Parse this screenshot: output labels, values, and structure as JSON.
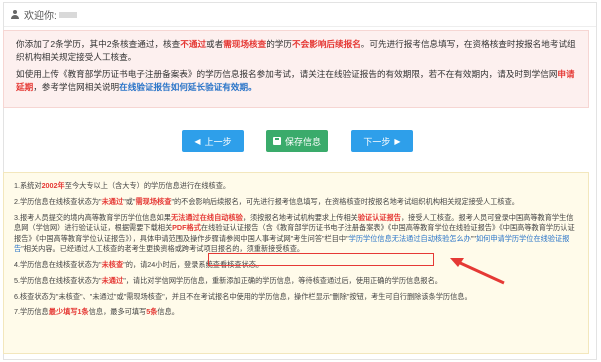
{
  "header": {
    "greeting": "欢迎你:"
  },
  "notice": {
    "p1_a": "你添加了2条学历，其中2条核查通过，核查",
    "p1_b": "不通过",
    "p1_c": "或者",
    "p1_d": "需现场核查",
    "p1_e": "的学历",
    "p1_f": "不会影响后续报名",
    "p1_g": "。可先进行报考信息填写，在资格核查时按报名地考试组织机构相关规定接受人工核查。",
    "p2_a": "如使用上传《教育部学历证书电子注册备案表》的学历信息报名参加考试，请关注在线验证报告的有效期限，若不在有效期内，请及时到学信网",
    "p2_b": "申请延期",
    "p2_c": "，参考学信网相关说明",
    "p2_d": "在线验证报告如何延长验证有效期。"
  },
  "buttons": {
    "prev": "上一步",
    "save": "保存信息",
    "next": "下一步"
  },
  "notes": {
    "n1_a": "1.系统对",
    "n1_b": "2002年",
    "n1_c": "至今大专以上（含大专）的学历信息进行在线核查。",
    "n2_a": "2.学历信息在线核查状态为\"",
    "n2_b": "未通过",
    "n2_c": "\"或\"",
    "n2_d": "需现场核查",
    "n2_e": "\"的不会影响后续报名，可先进行报考信息填写，在资格核查时按报名地考试组织机构相关规定接受人工核查。",
    "n3_a": "3.报考人员提交的境内高等教育学历学位信息如果",
    "n3_b": "无法通过在线自动核验",
    "n3_c": "，须按报名地考试机构要求上传相关",
    "n3_d": "验证认证报告",
    "n3_e": "，接受人工核查。报考人员可登录中国高等教育学生信息网（学信网）进行验证认证，根据需要下载相关",
    "n3_f": "PDF格式",
    "n3_g": "在线验证认证报告（含《教育部学历证书电子注册备案表》《中国高等教育学位在线验证报告》《中国高等教育学历认证报告》《中国高等教育学位认证报告》），具体申请范围及操作步骤请参阅中国人事考试网\"考生问答\"栏目中\"",
    "n3_h": "学历学位信息无法通过自动核验怎么办",
    "n3_i": "\"\"",
    "n3_j": "如何申请学历学位在线验证报告",
    "n3_k": "\"相关内容。",
    "n3_l": "已经通过人工核查的老考生更换资格或跨考试项目报名的，须重新接受核查。",
    "n4_a": "4.学历信息在线核查状态为\"",
    "n4_b": "未核查",
    "n4_c": "\"的，请24小时后，登录系统查看核查状态。",
    "n5_a": "5.学历信息在线核查状态为\"",
    "n5_b": "未通过",
    "n5_c": "\"，请比对学信网学历信息，重新添加正确的学历信息，等待核查通过后，使用正确的学历信息报名。",
    "n6": "6.核查状态为\"未核查\"、\"未通过\"或\"需现场核查\"，并且不在考试报名中使用的学历信息，操作栏显示\"删除\"按钮，考生可自行删除该条学历信息。",
    "n7_a": "7.学历信息",
    "n7_b": "最少填写1条",
    "n7_c": "信息，最多可填写",
    "n7_d": "5条",
    "n7_e": "信息。"
  },
  "colors": {
    "accent_red": "#e53935",
    "link_blue": "#2a74c8",
    "button_blue": "#2e9fea",
    "button_green": "#3aab6b"
  }
}
